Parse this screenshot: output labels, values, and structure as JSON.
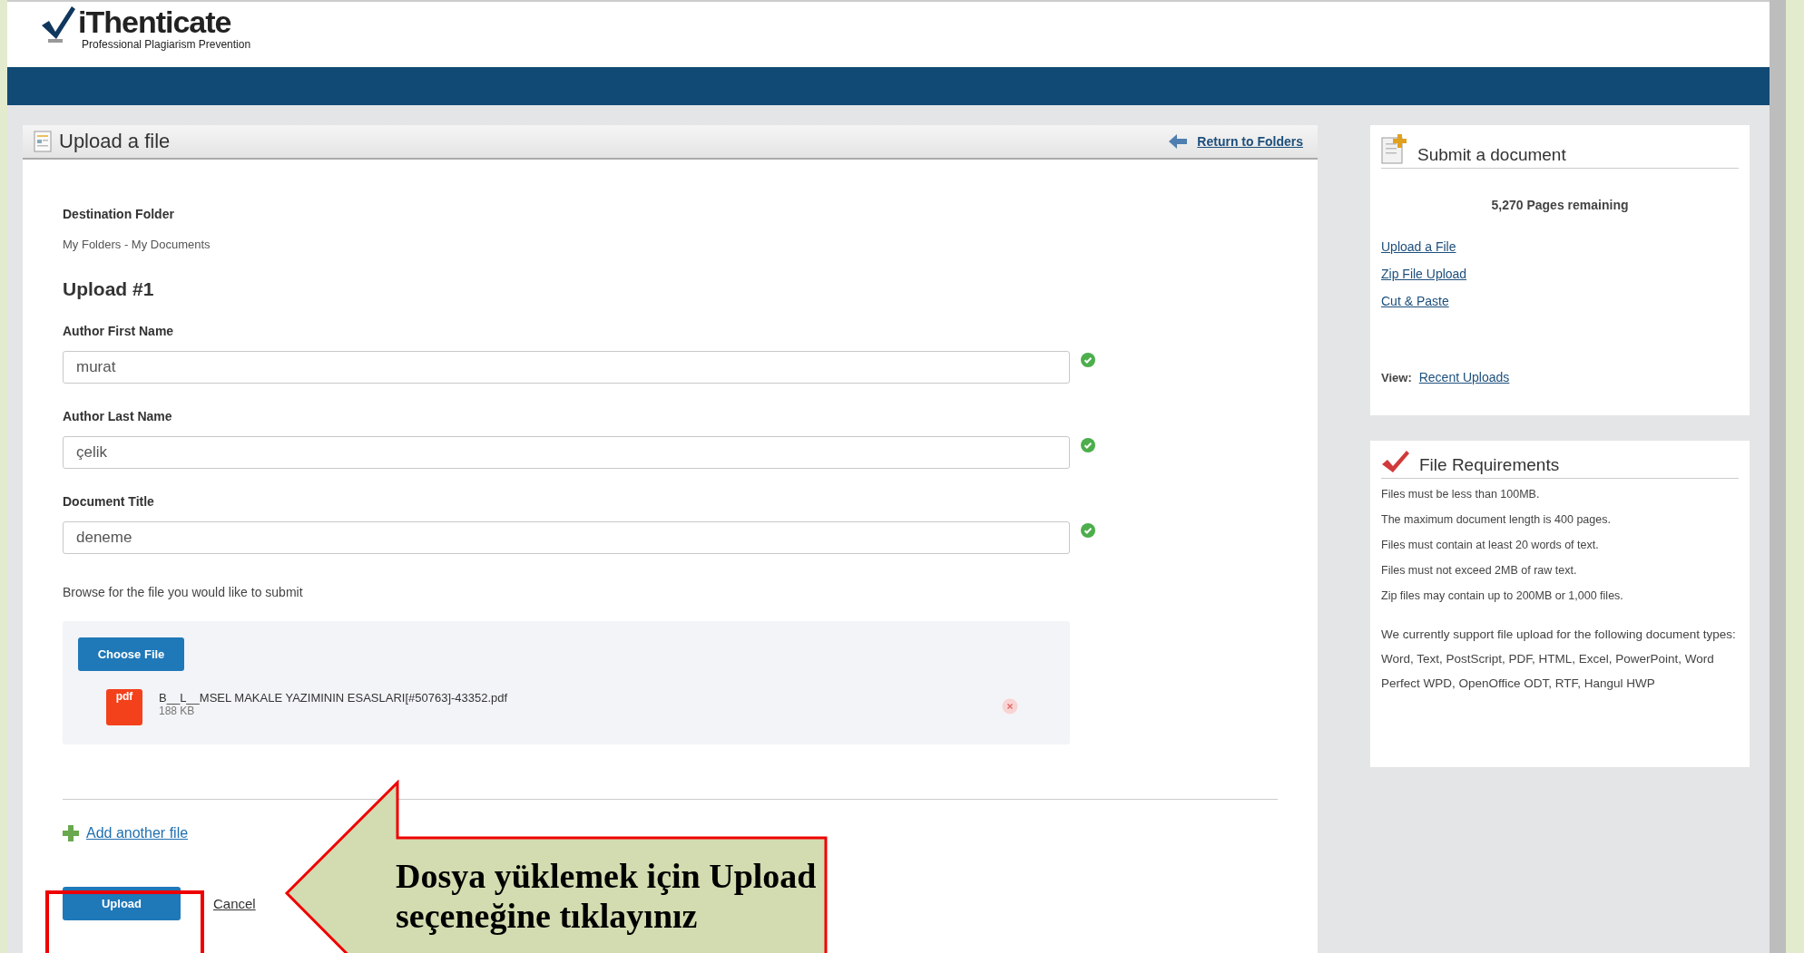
{
  "logo": {
    "name": "iThenticate",
    "tagline": "Professional Plagiarism Prevention"
  },
  "upload_panel": {
    "title": "Upload a file",
    "return_link": "Return to Folders",
    "destination_label": "Destination Folder",
    "destination_value": "My Folders - My Documents",
    "upload_heading": "Upload #1",
    "fields": [
      {
        "label": "Author First Name",
        "value": "murat",
        "valid": true
      },
      {
        "label": "Author Last Name",
        "value": "çelik",
        "valid": true
      },
      {
        "label": "Document Title",
        "value": "deneme",
        "valid": true
      }
    ],
    "browse_label": "Browse for the file you would like to submit",
    "choose_button": "Choose File",
    "file": {
      "type_badge": "pdf",
      "name": "B__L__MSEL MAKALE YAZIMININ ESASLARI[#50763]-43352.pdf",
      "size": "188 KB"
    },
    "add_link": "Add another file",
    "upload_button": "Upload",
    "cancel_link": "Cancel"
  },
  "submit_card": {
    "title": "Submit a document",
    "pages_remaining": "5,270 Pages remaining",
    "links": [
      "Upload a File",
      "Zip File Upload",
      "Cut & Paste"
    ],
    "view_label": "View:",
    "view_link": "Recent Uploads"
  },
  "requirements_card": {
    "title": "File Requirements",
    "rules": [
      "Files must be less than 100MB.",
      "The maximum document length is 400 pages.",
      "Files must contain at least 20 words of text.",
      "Files must not exceed 2MB of raw text.",
      "Zip files may contain up to 200MB or 1,000 files."
    ],
    "support_text": "We currently support file upload for the following document types:",
    "types_text": "Word, Text, PostScript, PDF, HTML, Excel, PowerPoint, Word Perfect WPD, OpenOffice ODT, RTF, Hangul HWP"
  },
  "annotation": {
    "text": "Dosya yüklemek için Upload seçeneğine tıklayınız"
  }
}
